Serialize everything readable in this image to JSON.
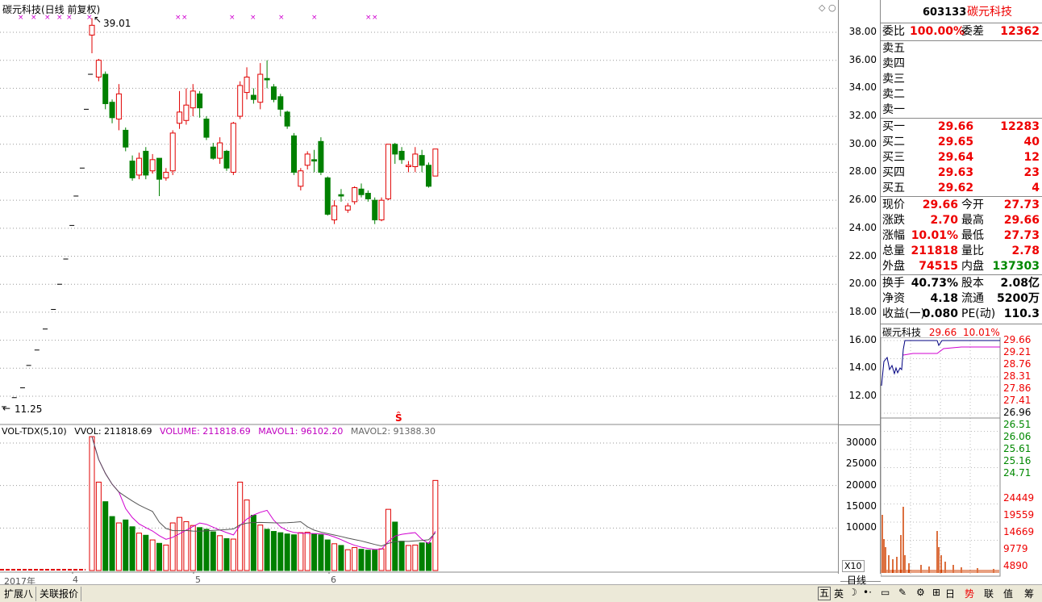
{
  "chart_title": "碳元科技(日线 前复权)",
  "price_high_label": "39.01",
  "price_low_label": "11.25",
  "vol_legend": {
    "name": "VOL-TDX(5,10)",
    "vvol": "VVOL: 211818.69",
    "volume": "VOLUME: 211818.69",
    "mavol1": "MAVOL1: 96102.20",
    "mavol2": "MAVOL2: 91388.30"
  },
  "x_labels": {
    "year": "2017年",
    "m4": "4",
    "m5": "5",
    "m6": "6"
  },
  "period_label": "日线",
  "x10_label": "X10",
  "price_axis": [
    "38.00",
    "36.00",
    "34.00",
    "32.00",
    "30.00",
    "28.00",
    "26.00",
    "24.00",
    "22.00",
    "20.00",
    "18.00",
    "16.00",
    "14.00",
    "12.00"
  ],
  "vol_axis": [
    "30000",
    "25000",
    "20000",
    "15000",
    "10000"
  ],
  "quote": {
    "code": "603133",
    "name": "碳元科技",
    "weibi_label": "委比",
    "weibi": "100.00%",
    "weicha_label": "委差",
    "weicha": "12362",
    "sell": [
      {
        "label": "卖五",
        "price": "",
        "vol": ""
      },
      {
        "label": "卖四",
        "price": "",
        "vol": ""
      },
      {
        "label": "卖三",
        "price": "",
        "vol": ""
      },
      {
        "label": "卖二",
        "price": "",
        "vol": ""
      },
      {
        "label": "卖一",
        "price": "",
        "vol": ""
      }
    ],
    "buy": [
      {
        "label": "买一",
        "price": "29.66",
        "vol": "12283"
      },
      {
        "label": "买二",
        "price": "29.65",
        "vol": "40"
      },
      {
        "label": "买三",
        "price": "29.64",
        "vol": "12"
      },
      {
        "label": "买四",
        "price": "29.63",
        "vol": "23"
      },
      {
        "label": "买五",
        "price": "29.62",
        "vol": "4"
      }
    ],
    "stats": [
      {
        "l1": "现价",
        "v1": "29.66",
        "c1": "red",
        "l2": "今开",
        "v2": "27.73",
        "c2": "red"
      },
      {
        "l1": "涨跌",
        "v1": "2.70",
        "c1": "red",
        "l2": "最高",
        "v2": "29.66",
        "c2": "red"
      },
      {
        "l1": "涨幅",
        "v1": "10.01%",
        "c1": "red",
        "l2": "最低",
        "v2": "27.73",
        "c2": "red"
      },
      {
        "l1": "总量",
        "v1": "211818",
        "c1": "red",
        "l2": "量比",
        "v2": "2.78",
        "c2": "red"
      },
      {
        "l1": "外盘",
        "v1": "74515",
        "c1": "red",
        "l2": "内盘",
        "v2": "137303",
        "c2": "green"
      }
    ],
    "fund": [
      {
        "l1": "换手",
        "v1": "40.73%",
        "l2": "股本",
        "v2": "2.08亿"
      },
      {
        "l1": "净资",
        "v1": "4.18",
        "l2": "流通",
        "v2": "5200万"
      },
      {
        "l1": "收益(一)",
        "v1": "0.080",
        "l2": "PE(动)",
        "v2": "110.3"
      }
    ],
    "mini_title": "碳元科技",
    "mini_price": "29.66",
    "mini_pct": "10.01%",
    "mini_price_axis": [
      "29.66",
      "29.21",
      "28.76",
      "28.31",
      "27.86",
      "27.41",
      "26.96",
      "26.51",
      "26.06",
      "25.61",
      "25.16",
      "24.71"
    ],
    "mini_vol_axis": [
      "24449",
      "19559",
      "14669",
      "9779",
      "4890"
    ]
  },
  "bottom_tabs": [
    "扩展八",
    "关联报价"
  ],
  "bottom_right": [
    "五",
    "英",
    "日",
    "势",
    "联",
    "值",
    "筹"
  ],
  "chart_data": {
    "type": "candlestick",
    "title": "碳元科技(日线 前复权)",
    "ylim": [
      11,
      40
    ],
    "candles": [
      {
        "o": 37.8,
        "c": 38.5,
        "h": 39.01,
        "l": 36.5
      },
      {
        "o": 34.8,
        "c": 36.0,
        "h": 36.1,
        "l": 34.5
      },
      {
        "o": 35.0,
        "c": 32.9,
        "h": 35.2,
        "l": 32.5
      },
      {
        "o": 33.0,
        "c": 31.9,
        "h": 33.2,
        "l": 31.5
      },
      {
        "o": 31.8,
        "c": 33.6,
        "h": 34.3,
        "l": 31.0
      },
      {
        "o": 31.0,
        "c": 29.8,
        "h": 31.2,
        "l": 29.5
      },
      {
        "o": 28.8,
        "c": 27.6,
        "h": 29.2,
        "l": 27.4
      },
      {
        "o": 27.8,
        "c": 29.0,
        "h": 29.4,
        "l": 27.5
      },
      {
        "o": 29.5,
        "c": 27.8,
        "h": 29.8,
        "l": 27.5
      },
      {
        "o": 28.1,
        "c": 28.9,
        "h": 29.3,
        "l": 27.9
      },
      {
        "o": 29.0,
        "c": 27.5,
        "h": 29.0,
        "l": 26.3
      },
      {
        "o": 27.6,
        "c": 28.0,
        "h": 28.3,
        "l": 27.4
      },
      {
        "o": 28.1,
        "c": 30.8,
        "h": 31.0,
        "l": 27.8
      },
      {
        "o": 31.5,
        "c": 32.3,
        "h": 33.8,
        "l": 31.1
      },
      {
        "o": 31.7,
        "c": 32.8,
        "h": 34.0,
        "l": 31.4
      },
      {
        "o": 32.6,
        "c": 33.8,
        "h": 34.3,
        "l": 32.0
      },
      {
        "o": 33.6,
        "c": 32.6,
        "h": 33.8,
        "l": 31.9
      },
      {
        "o": 31.8,
        "c": 30.5,
        "h": 32.0,
        "l": 30.3
      },
      {
        "o": 29.8,
        "c": 29.0,
        "h": 30.1,
        "l": 28.9
      },
      {
        "o": 29.0,
        "c": 30.1,
        "h": 30.5,
        "l": 28.6
      },
      {
        "o": 29.5,
        "c": 28.3,
        "h": 29.6,
        "l": 28.1
      },
      {
        "o": 28.0,
        "c": 31.5,
        "h": 31.6,
        "l": 27.8
      },
      {
        "o": 32.0,
        "c": 34.2,
        "h": 34.5,
        "l": 31.8
      },
      {
        "o": 33.7,
        "c": 34.8,
        "h": 35.5,
        "l": 33.2
      },
      {
        "o": 33.5,
        "c": 33.2,
        "h": 34.0,
        "l": 32.9
      },
      {
        "o": 33.0,
        "c": 35.0,
        "h": 35.8,
        "l": 32.5
      },
      {
        "o": 34.7,
        "c": 34.6,
        "h": 36.0,
        "l": 34.0
      },
      {
        "o": 34.1,
        "c": 33.2,
        "h": 34.3,
        "l": 33.0
      },
      {
        "o": 33.4,
        "c": 32.5,
        "h": 33.6,
        "l": 32.0
      },
      {
        "o": 32.3,
        "c": 31.3,
        "h": 32.4,
        "l": 31.1
      },
      {
        "o": 30.6,
        "c": 28.0,
        "h": 30.8,
        "l": 27.8
      },
      {
        "o": 27.0,
        "c": 28.1,
        "h": 28.3,
        "l": 26.7
      },
      {
        "o": 28.5,
        "c": 29.3,
        "h": 29.5,
        "l": 28.2
      },
      {
        "o": 28.9,
        "c": 28.8,
        "h": 29.6,
        "l": 28.0
      },
      {
        "o": 30.2,
        "c": 28.0,
        "h": 30.5,
        "l": 27.8
      },
      {
        "o": 27.6,
        "c": 25.0,
        "h": 27.7,
        "l": 24.9
      },
      {
        "o": 24.6,
        "c": 25.6,
        "h": 26.0,
        "l": 24.3
      },
      {
        "o": 26.4,
        "c": 26.3,
        "h": 26.8,
        "l": 25.9
      },
      {
        "o": 25.3,
        "c": 25.6,
        "h": 25.8,
        "l": 25.1
      },
      {
        "o": 25.9,
        "c": 26.9,
        "h": 27.0,
        "l": 25.7
      },
      {
        "o": 26.8,
        "c": 26.4,
        "h": 27.2,
        "l": 26.2
      },
      {
        "o": 26.5,
        "c": 26.1,
        "h": 26.7,
        "l": 25.9
      },
      {
        "o": 26.0,
        "c": 24.6,
        "h": 26.2,
        "l": 24.3
      },
      {
        "o": 24.6,
        "c": 26.0,
        "h": 26.2,
        "l": 24.5
      },
      {
        "o": 26.1,
        "c": 30.0,
        "h": 30.0,
        "l": 26.0
      },
      {
        "o": 30.0,
        "c": 29.3,
        "h": 30.1,
        "l": 28.6
      },
      {
        "o": 29.5,
        "c": 28.9,
        "h": 29.8,
        "l": 28.6
      },
      {
        "o": 28.4,
        "c": 28.5,
        "h": 28.8,
        "l": 28.0
      },
      {
        "o": 28.4,
        "c": 29.3,
        "h": 29.8,
        "l": 28.0
      },
      {
        "o": 29.2,
        "c": 28.5,
        "h": 29.6,
        "l": 28.0
      },
      {
        "o": 28.5,
        "c": 27.0,
        "h": 28.7,
        "l": 26.9
      },
      {
        "o": 27.73,
        "c": 29.66,
        "h": 29.66,
        "l": 27.73
      }
    ],
    "volumes": [
      31500,
      20800,
      16200,
      12700,
      11200,
      11900,
      10300,
      8800,
      8300,
      7200,
      6400,
      6000,
      11200,
      12500,
      11500,
      10600,
      10100,
      9700,
      9100,
      8200,
      7500,
      7400,
      20800,
      16600,
      13000,
      10700,
      9700,
      9200,
      8900,
      8600,
      8400,
      8900,
      9000,
      8600,
      8400,
      7200,
      6300,
      5900,
      4900,
      5400,
      5000,
      4800,
      4800,
      5100,
      14400,
      11400,
      6900,
      5900,
      6000,
      6500,
      6500,
      21200
    ],
    "ramp_points": [
      [
        0,
        11.25
      ],
      [
        5,
        11.9
      ],
      [
        9,
        12.6
      ],
      [
        12,
        14.2
      ],
      [
        16,
        15.3
      ],
      [
        20,
        16.8
      ],
      [
        24,
        18.2
      ],
      [
        27,
        20.0
      ],
      [
        30,
        21.8
      ],
      [
        33,
        24.2
      ],
      [
        35,
        26.3
      ],
      [
        38,
        28.3
      ],
      [
        40,
        32.5
      ],
      [
        42,
        35.0
      ]
    ]
  }
}
